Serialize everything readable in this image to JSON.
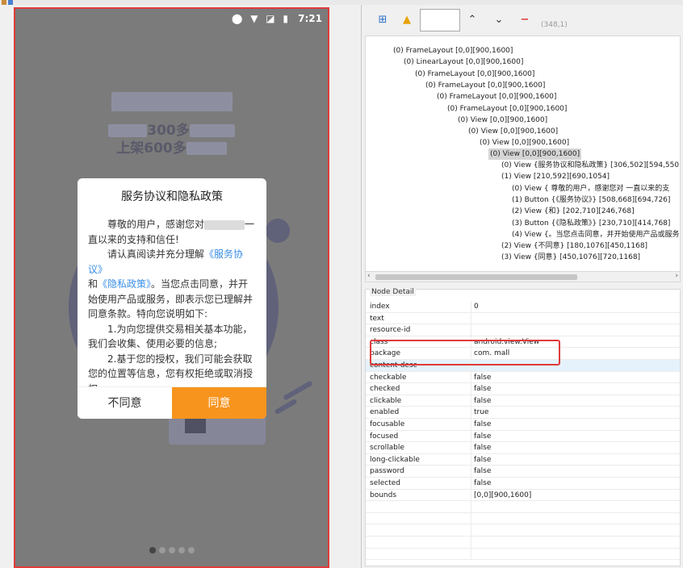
{
  "device": {
    "status": {
      "time": "7:21",
      "icons": "⬤ ▼ ◪ ▮"
    },
    "background": {
      "line2_text": "300多",
      "line3_text": "上架600多"
    },
    "dialog": {
      "title": "服务协议和隐私政策",
      "para1_a": "尊敬的用户，感谢您对",
      "para1_b": "一直以来的支持和信任!",
      "para2_a": "请认真阅读并充分理解",
      "link_service": "《服务协议》",
      "and": "和",
      "link_privacy": "《隐私政策》",
      "para2_b": "。当您点击同意，并开始使用产品或服务，即表示您已理解并同意条款。特向您说明如下:",
      "item1": "1.为向您提供交易相关基本功能，我们会收集、使用必要的信息;",
      "item2": "2.基于您的授权，我们可能会获取您的位置等信息，您有权拒绝或取消授权;",
      "btn_disagree": "不同意",
      "btn_agree": "同意"
    },
    "pager": {
      "count": 5,
      "active": 0
    }
  },
  "inspector": {
    "toolbar": {
      "coords": "(348,1)"
    },
    "tree": [
      "(0) FrameLayout [0,0][900,1600]",
      "(0) LinearLayout [0,0][900,1600]",
      "(0) FrameLayout [0,0][900,1600]",
      "(0) FrameLayout [0,0][900,1600]",
      "(0) FrameLayout [0,0][900,1600]",
      "(0) FrameLayout [0,0][900,1600]",
      "(0) View [0,0][900,1600]",
      "(0) View [0,0][900,1600]",
      "(0) View [0,0][900,1600]",
      "(0) View [0,0][900,1600]",
      "(0) View {服务协议和隐私政策} [306,502][594,550]",
      "(1) View [210,592][690,1054]",
      "(0) View {    尊敬的用户，感谢您对      一直以来的支",
      "(1) Button {《服务协议》} [508,668][694,726]",
      "(2) View {和} [202,710][246,768]",
      "(3) Button {《隐私政策》} [230,710][414,768]",
      "(4) View {。当您点击同意，并开始使用产品或服务，即",
      "(2) View {不同意} [180,1076][450,1168]",
      "(3) View {同意} [450,1076][720,1168]"
    ],
    "detail": {
      "title": "Node Detail",
      "rows": [
        {
          "k": "index",
          "v": "0"
        },
        {
          "k": "text",
          "v": ""
        },
        {
          "k": "resource-id",
          "v": ""
        },
        {
          "k": "class",
          "v": "android.view.View"
        },
        {
          "k": "package",
          "v": "com.        mall"
        },
        {
          "k": "content-desc",
          "v": ""
        },
        {
          "k": "checkable",
          "v": "false"
        },
        {
          "k": "checked",
          "v": "false"
        },
        {
          "k": "clickable",
          "v": "false"
        },
        {
          "k": "enabled",
          "v": "true"
        },
        {
          "k": "focusable",
          "v": "false"
        },
        {
          "k": "focused",
          "v": "false"
        },
        {
          "k": "scrollable",
          "v": "false"
        },
        {
          "k": "long-clickable",
          "v": "false"
        },
        {
          "k": "password",
          "v": "false"
        },
        {
          "k": "selected",
          "v": "false"
        },
        {
          "k": "bounds",
          "v": "[0,0][900,1600]"
        }
      ]
    }
  },
  "colors": {
    "accent": "#f7941d",
    "link": "#3a8ee6",
    "highlight_border": "#e03b3b"
  }
}
